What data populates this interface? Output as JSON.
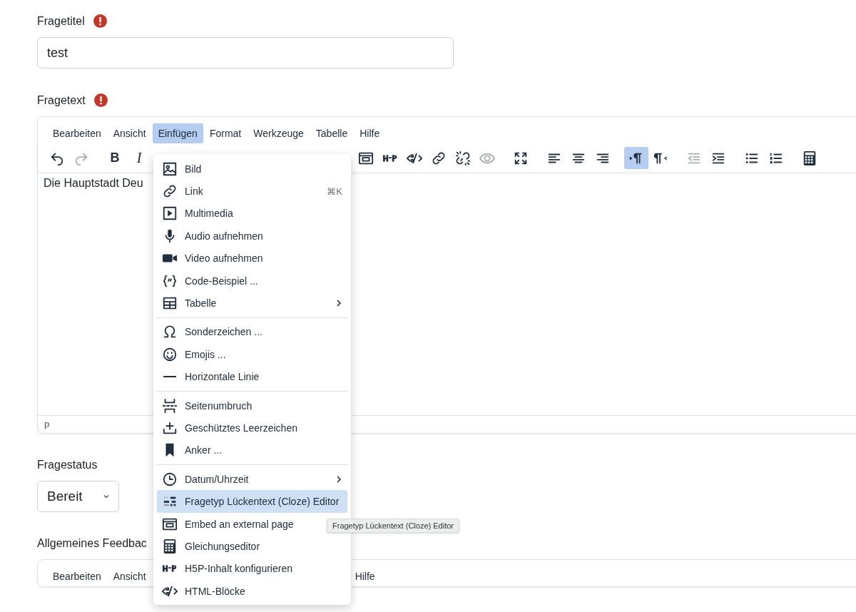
{
  "fields": [
    {
      "kind": "text",
      "label": "Fragetitel",
      "required": true,
      "value": "test"
    },
    {
      "kind": "editor",
      "label": "Fragetext",
      "required": true,
      "menubar": [
        {
          "label": "Bearbeiten",
          "selected": false
        },
        {
          "label": "Ansicht",
          "selected": false
        },
        {
          "label": "Einfügen",
          "selected": true
        },
        {
          "label": "Format",
          "selected": false
        },
        {
          "label": "Werkzeuge",
          "selected": false
        },
        {
          "label": "Tabelle",
          "selected": false
        },
        {
          "label": "Hilfe",
          "selected": false
        }
      ],
      "toolbar": [
        [
          {
            "kind": "undo",
            "disabled": false,
            "active": false
          },
          {
            "kind": "redo",
            "disabled": true,
            "active": false
          }
        ],
        [
          {
            "kind": "bold",
            "text": "B",
            "disabled": false,
            "active": false
          },
          {
            "kind": "italic",
            "text": "I",
            "disabled": false,
            "active": false
          }
        ],
        [
          {
            "kind": "embed",
            "disabled": false,
            "active": false
          },
          {
            "kind": "h5p",
            "disabled": false,
            "active": false
          },
          {
            "kind": "html",
            "disabled": false,
            "active": false
          },
          {
            "kind": "link",
            "disabled": false,
            "active": false
          },
          {
            "kind": "unlink",
            "disabled": false,
            "active": false
          },
          {
            "kind": "eye",
            "disabled": true,
            "active": false
          }
        ],
        [
          {
            "kind": "fullscreen",
            "disabled": false,
            "active": false
          }
        ],
        [
          {
            "kind": "align-left",
            "disabled": false,
            "active": false
          },
          {
            "kind": "align-center",
            "disabled": false,
            "active": false
          },
          {
            "kind": "align-right",
            "disabled": false,
            "active": false
          }
        ],
        [
          {
            "kind": "ltr",
            "disabled": false,
            "active": true
          },
          {
            "kind": "rtl",
            "disabled": false,
            "active": false
          }
        ],
        [
          {
            "kind": "outdent",
            "disabled": true,
            "active": false
          },
          {
            "kind": "indent",
            "disabled": false,
            "active": false
          }
        ],
        [
          {
            "kind": "bullets",
            "disabled": false,
            "active": false
          },
          {
            "kind": "numbers",
            "disabled": false,
            "active": false
          }
        ],
        [
          {
            "kind": "calculator",
            "disabled": false,
            "active": false
          }
        ]
      ],
      "content": "Die Hauptstadt Deu",
      "status": "p"
    },
    {
      "kind": "select",
      "label": "Fragestatus",
      "required": false,
      "value": "Bereit"
    },
    {
      "kind": "editor",
      "label": "Allgemeines Feedbac",
      "required": false,
      "menubar": [
        {
          "label": "Bearbeiten",
          "selected": false
        },
        {
          "label": "Ansicht",
          "selected": false
        },
        {
          "label": "Hilfe",
          "selected": false
        }
      ]
    }
  ],
  "menu": {
    "groups": [
      [
        {
          "kind": "image",
          "label": "Bild",
          "selected": false,
          "submenu": false
        },
        {
          "kind": "link",
          "label": "Link",
          "shortcut": "⌘K",
          "selected": false,
          "submenu": false
        },
        {
          "kind": "media",
          "label": "Multimedia",
          "selected": false,
          "submenu": false
        },
        {
          "kind": "mic",
          "label": "Audio aufnehmen",
          "selected": false,
          "submenu": false
        },
        {
          "kind": "video",
          "label": "Video aufnehmen",
          "selected": false,
          "submenu": false
        },
        {
          "kind": "code",
          "label": "Code-Beispiel ...",
          "selected": false,
          "submenu": false
        },
        {
          "kind": "table",
          "label": "Tabelle",
          "selected": false,
          "submenu": true
        }
      ],
      [
        {
          "kind": "omega",
          "label": "Sonderzeichen ...",
          "selected": false,
          "submenu": false
        },
        {
          "kind": "emoji",
          "label": "Emojis ...",
          "selected": false,
          "submenu": false
        },
        {
          "kind": "hr",
          "label": "Horizontale Linie",
          "selected": false,
          "submenu": false
        }
      ],
      [
        {
          "kind": "pagebreak",
          "label": "Seitenumbruch",
          "selected": false,
          "submenu": false
        },
        {
          "kind": "nbsp",
          "label": "Geschütztes Leerzeichen",
          "selected": false,
          "submenu": false
        },
        {
          "kind": "bookmark",
          "label": "Anker ...",
          "selected": false,
          "submenu": false
        }
      ],
      [
        {
          "kind": "clock",
          "label": "Datum/Uhrzeit",
          "selected": false,
          "submenu": true
        },
        {
          "kind": "cloze",
          "label": "Fragetyp Lückentext (Cloze) Editor",
          "selected": true,
          "submenu": false
        },
        {
          "kind": "embed",
          "label": "Embed an external page",
          "selected": false,
          "submenu": false
        },
        {
          "kind": "calculator",
          "label": "Gleichungseditor",
          "selected": false,
          "submenu": false
        },
        {
          "kind": "h5p",
          "label": "H5P-Inhalt konfigurieren",
          "selected": false,
          "submenu": false
        },
        {
          "kind": "html",
          "label": "HTML-Blöcke",
          "selected": false,
          "submenu": false
        }
      ]
    ]
  },
  "tooltip": "Fragetyp Lückentext (Cloze) Editor"
}
